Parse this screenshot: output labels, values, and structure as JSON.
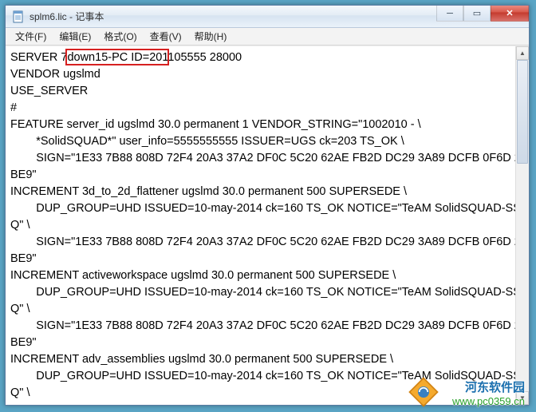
{
  "window": {
    "title": "splm6.lic - 记事本"
  },
  "menu": {
    "file": "文件(F)",
    "edit": "编辑(E)",
    "format": "格式(O)",
    "view": "查看(V)",
    "help": "帮助(H)"
  },
  "highlight": {
    "text": "7down15-PC ID="
  },
  "lines": [
    "SERVER 7down15-PC ID=201105555 28000",
    "VENDOR ugslmd",
    "USE_SERVER",
    "#",
    "FEATURE server_id ugslmd 30.0 permanent 1 VENDOR_STRING=\"1002010 - \\",
    "        *SolidSQUAD*\" user_info=5555555555 ISSUER=UGS ck=203 TS_OK \\",
    "        SIGN=\"1E33 7B88 808D 72F4 20A3 37A2 DF0C 5C20 62AE FB2D DC29 3A89 DCFB 0F6D 2BE9\"",
    "INCREMENT 3d_to_2d_flattener ugslmd 30.0 permanent 500 SUPERSEDE \\",
    "        DUP_GROUP=UHD ISSUED=10-may-2014 ck=160 TS_OK NOTICE=\"TeAM SolidSQUAD-SSQ\" \\",
    "        SIGN=\"1E33 7B88 808D 72F4 20A3 37A2 DF0C 5C20 62AE FB2D DC29 3A89 DCFB 0F6D 2BE9\"",
    "INCREMENT activeworkspace ugslmd 30.0 permanent 500 SUPERSEDE \\",
    "        DUP_GROUP=UHD ISSUED=10-may-2014 ck=160 TS_OK NOTICE=\"TeAM SolidSQUAD-SSQ\" \\",
    "        SIGN=\"1E33 7B88 808D 72F4 20A3 37A2 DF0C 5C20 62AE FB2D DC29 3A89 DCFB 0F6D 2BE9\"",
    "INCREMENT adv_assemblies ugslmd 30.0 permanent 500 SUPERSEDE \\",
    "        DUP_GROUP=UHD ISSUED=10-may-2014 ck=160 TS_OK NOTICE=\"TeAM SolidSQUAD-SSQ\" \\"
  ],
  "watermark": {
    "name": "河东软件园",
    "url": "www.pc0359.cn"
  }
}
